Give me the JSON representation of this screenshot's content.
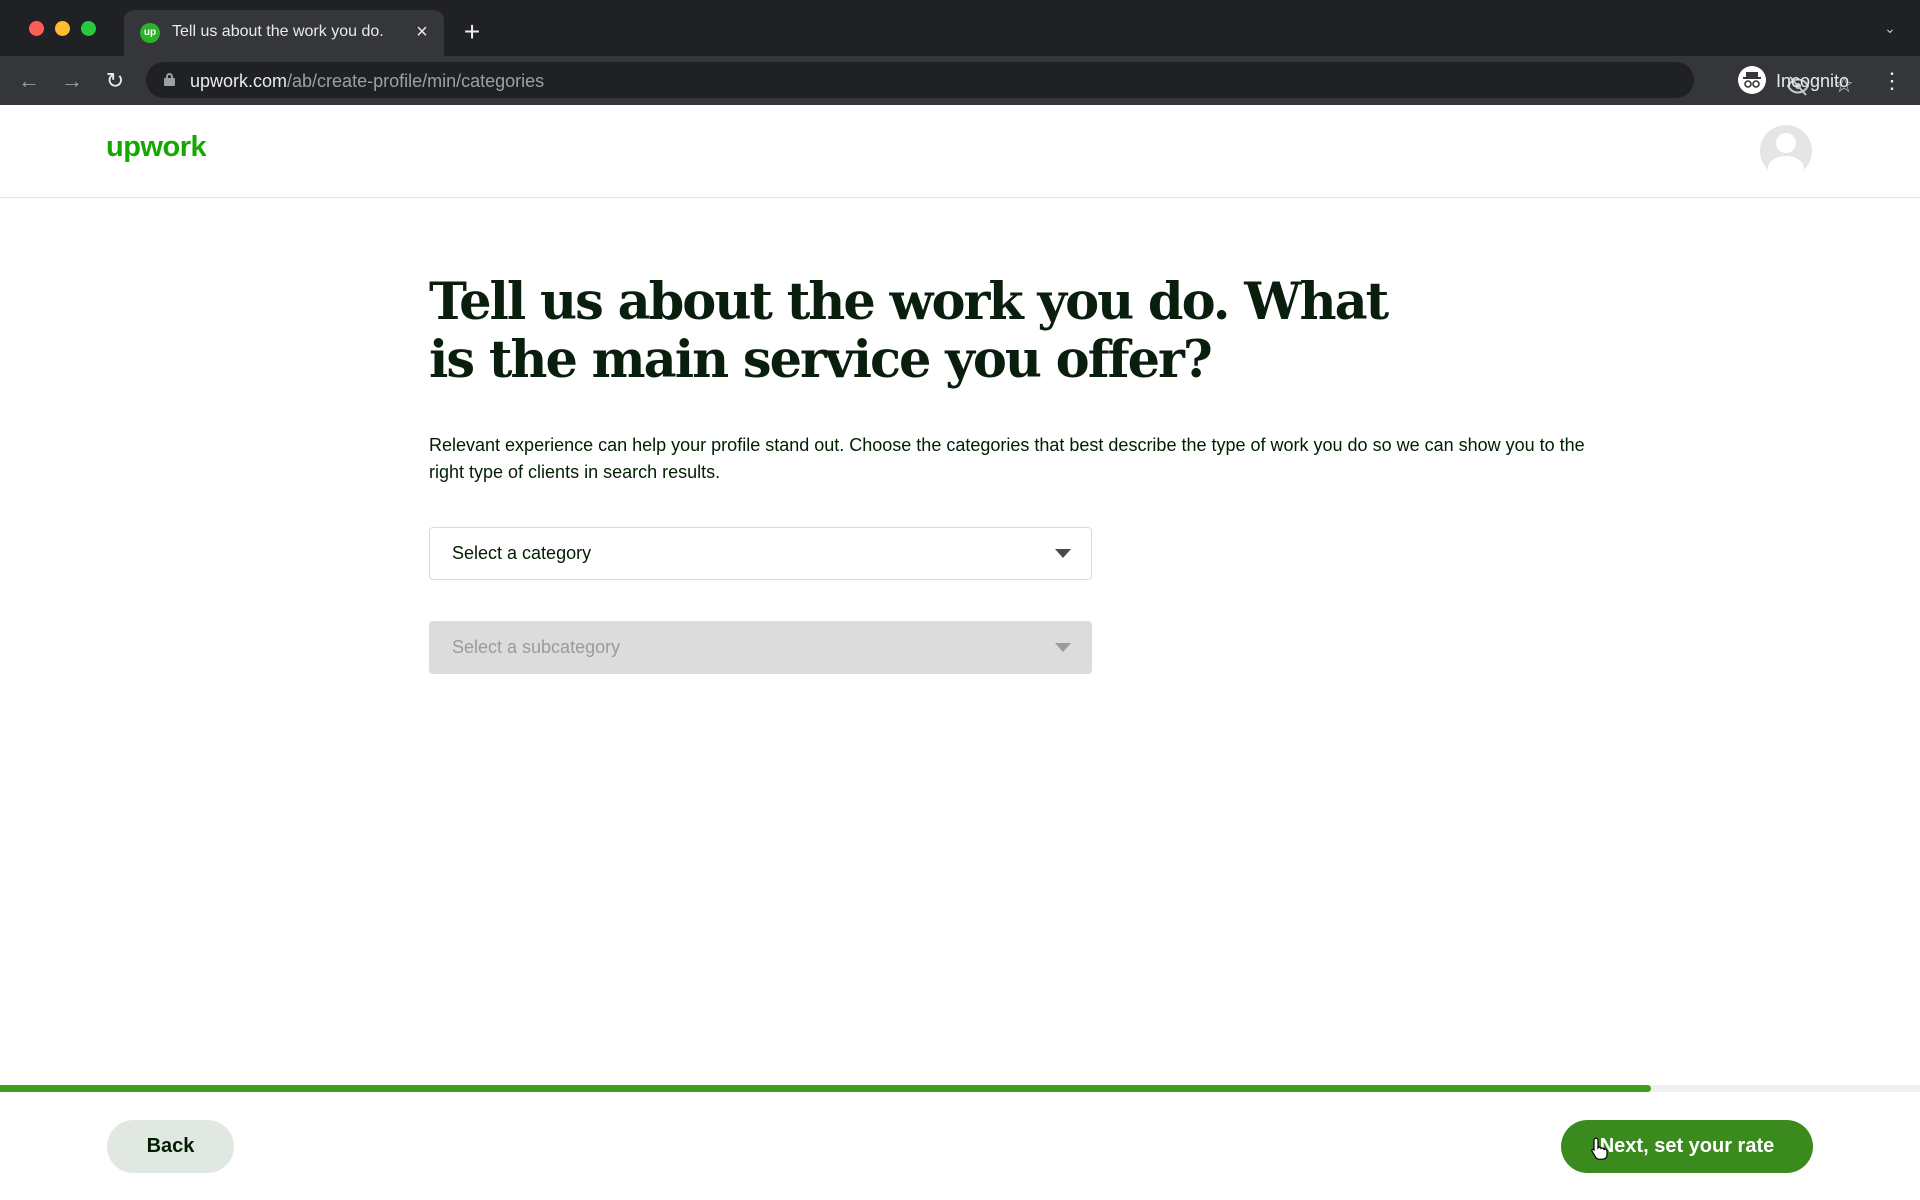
{
  "browser": {
    "tab": {
      "favicon_text": "up",
      "title": "Tell us about the work you do.",
      "close_glyph": "×"
    },
    "new_tab_glyph": "+",
    "tab_menu_glyph": "⌄",
    "nav": {
      "back_glyph": "←",
      "forward_glyph": "→",
      "reload_glyph": "↻"
    },
    "address": {
      "host": "upwork.com",
      "path": "/ab/create-profile/min/categories"
    },
    "bookmark_glyph": "☆",
    "profile_label": "Incognito",
    "menu_glyph": "⋮"
  },
  "header": {
    "logo": "upwork"
  },
  "main": {
    "title": "Tell us about the work you do. What is the main service you offer?",
    "description": "Relevant experience can help your profile stand out. Choose the categories that best describe the type of work you do so we can show you to the right type of clients in search results.",
    "category_select": {
      "placeholder": "Select a category",
      "disabled": false
    },
    "subcategory_select": {
      "placeholder": "Select a subcategory",
      "disabled": true
    }
  },
  "footer": {
    "progress_percent": 86,
    "back_label": "Back",
    "next_label": "Next, set your rate"
  },
  "colors": {
    "brand_green": "#14a800",
    "progress_green": "#3c9f1b",
    "next_button": "#3a8a1e",
    "back_button": "#e0e8e1"
  }
}
